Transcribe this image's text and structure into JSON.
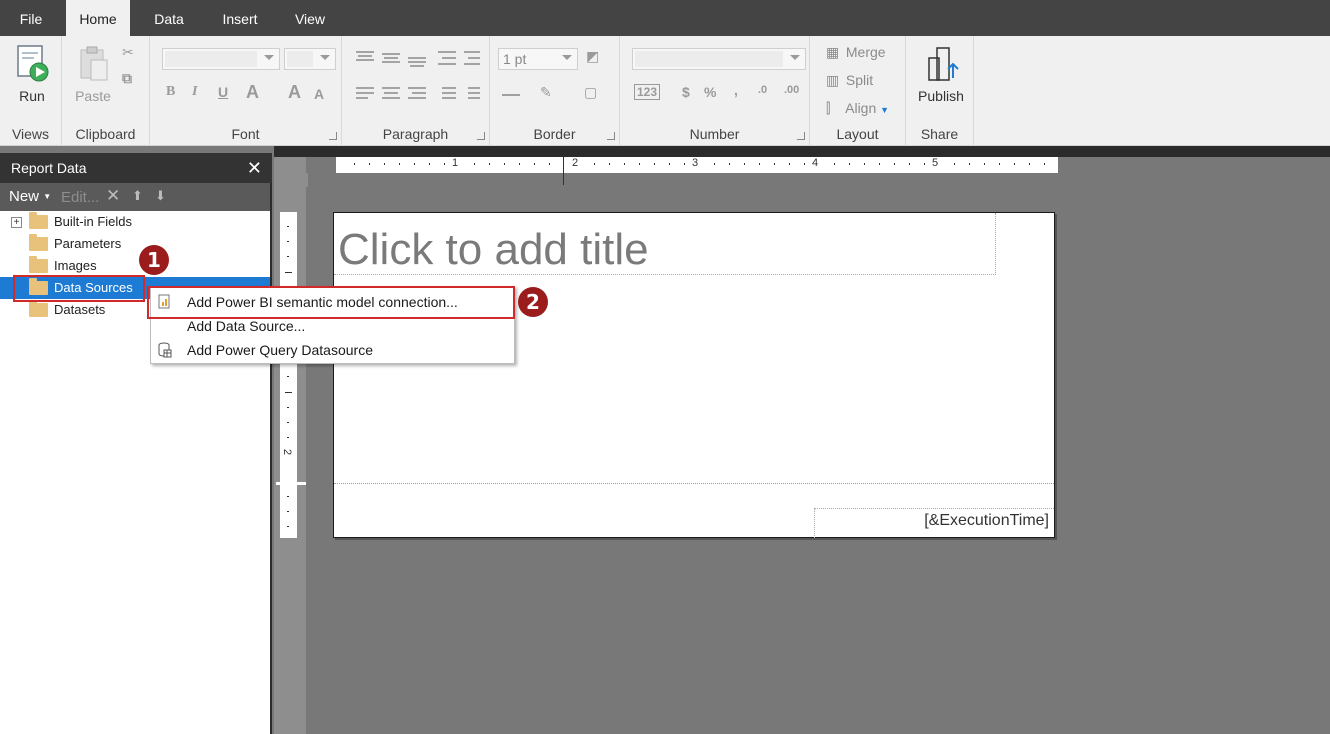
{
  "menubar": {
    "tabs": [
      "File",
      "Home",
      "Data",
      "Insert",
      "View"
    ],
    "active": "Home"
  },
  "ribbon": {
    "views": {
      "run_label": "Run",
      "group_label": "Views"
    },
    "clipboard": {
      "paste_label": "Paste",
      "group_label": "Clipboard"
    },
    "font": {
      "group_label": "Font"
    },
    "paragraph": {
      "group_label": "Paragraph"
    },
    "border": {
      "width_value": "1 pt",
      "group_label": "Border"
    },
    "number": {
      "group_label": "Number"
    },
    "layout": {
      "merge_label": "Merge",
      "split_label": "Split",
      "align_label": "Align",
      "group_label": "Layout"
    },
    "share": {
      "publish_label": "Publish",
      "group_label": "Share"
    }
  },
  "report_data_panel": {
    "title": "Report Data",
    "close_glyph": "✕",
    "toolbar": {
      "new_label": "New",
      "edit_label": "Edit..."
    },
    "tree": [
      {
        "label": "Built-in Fields",
        "expandable": true
      },
      {
        "label": "Parameters"
      },
      {
        "label": "Images"
      },
      {
        "label": "Data Sources",
        "selected": true
      },
      {
        "label": "Datasets"
      }
    ]
  },
  "context_menu": {
    "items": [
      {
        "label": "Add Power BI semantic model connection...",
        "icon": "pbi-dataset-icon"
      },
      {
        "label": "Add Data Source...",
        "icon": ""
      },
      {
        "label": "Add Power Query Datasource",
        "icon": "power-query-icon"
      }
    ]
  },
  "canvas": {
    "title_placeholder": "Click to add title",
    "footer_expression": "[&ExecutionTime]",
    "ruler_top_numbers": [
      "1",
      "2",
      "3",
      "4",
      "5"
    ],
    "ruler_left_numbers": [
      "1",
      "2"
    ]
  },
  "callouts": {
    "step1": "1",
    "step2": "2"
  },
  "colors": {
    "accent": "#1e7bd4",
    "callout": "#d12a2a",
    "badge": "#9a1c1c"
  }
}
